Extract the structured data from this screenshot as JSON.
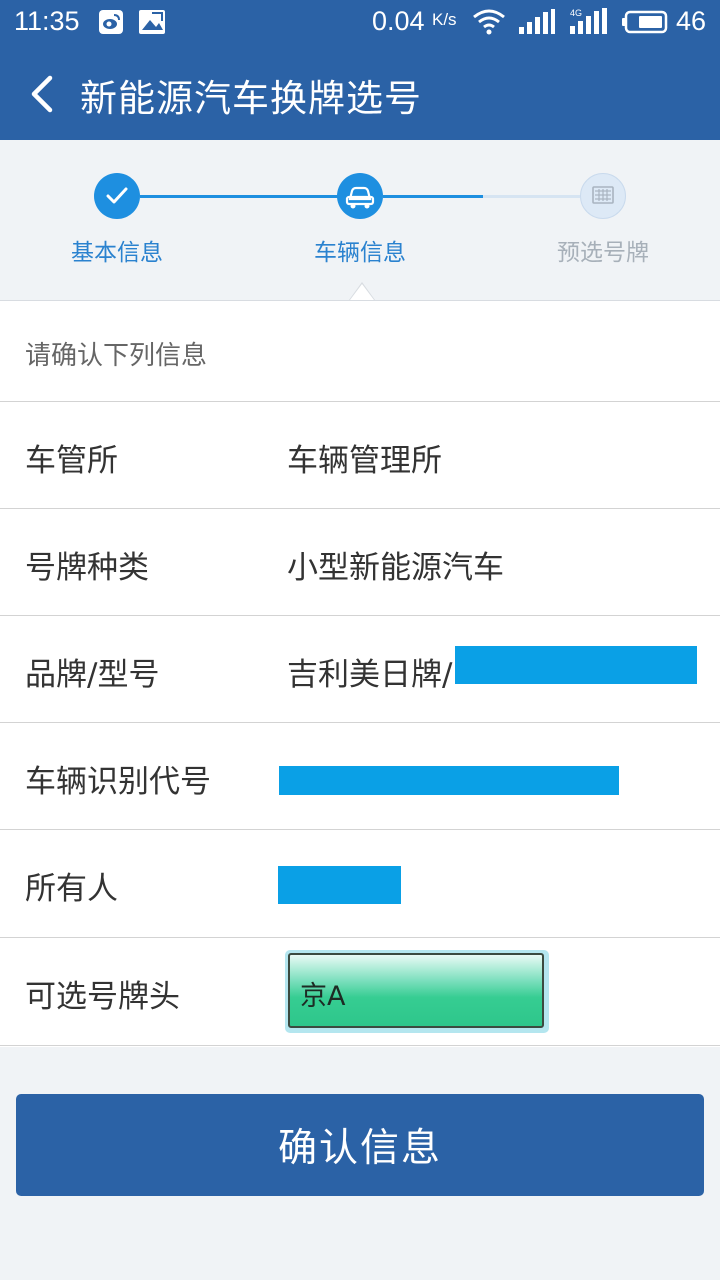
{
  "status_bar": {
    "time": "11:35",
    "speed": "0.04",
    "speed_unit": "K/s",
    "battery_level": "46",
    "network_label": "4G",
    "icons": [
      "weibo-icon",
      "image-icon",
      "wifi-icon",
      "signal-icon",
      "signal-4g-icon",
      "battery-icon"
    ]
  },
  "nav": {
    "title": "新能源汽车换牌选号",
    "back_icon": "chevron-left-icon"
  },
  "steps": [
    {
      "label": "基本信息",
      "state": "done",
      "icon": "check-icon"
    },
    {
      "label": "车辆信息",
      "state": "active",
      "icon": "car-icon"
    },
    {
      "label": "预选号牌",
      "state": "pending",
      "icon": "plate-grid-icon"
    }
  ],
  "colors": {
    "primary": "#2b62a6",
    "step_active": "#1e8fe0",
    "step_pending": "#dde9f6",
    "redaction": "#0aa0e6",
    "plate_green": "#2ec68b"
  },
  "form": {
    "hint": "请确认下列信息",
    "rows": [
      {
        "label": "车管所",
        "value": "车辆管理所"
      },
      {
        "label": "号牌种类",
        "value": "小型新能源汽车"
      },
      {
        "label": "品牌/型号",
        "value": "吉利美日牌/"
      },
      {
        "label": "车辆识别代号",
        "value": ""
      },
      {
        "label": "所有人",
        "value": ""
      },
      {
        "label": "可选号牌头",
        "value": "京A"
      }
    ]
  },
  "confirm_button": "确认信息"
}
